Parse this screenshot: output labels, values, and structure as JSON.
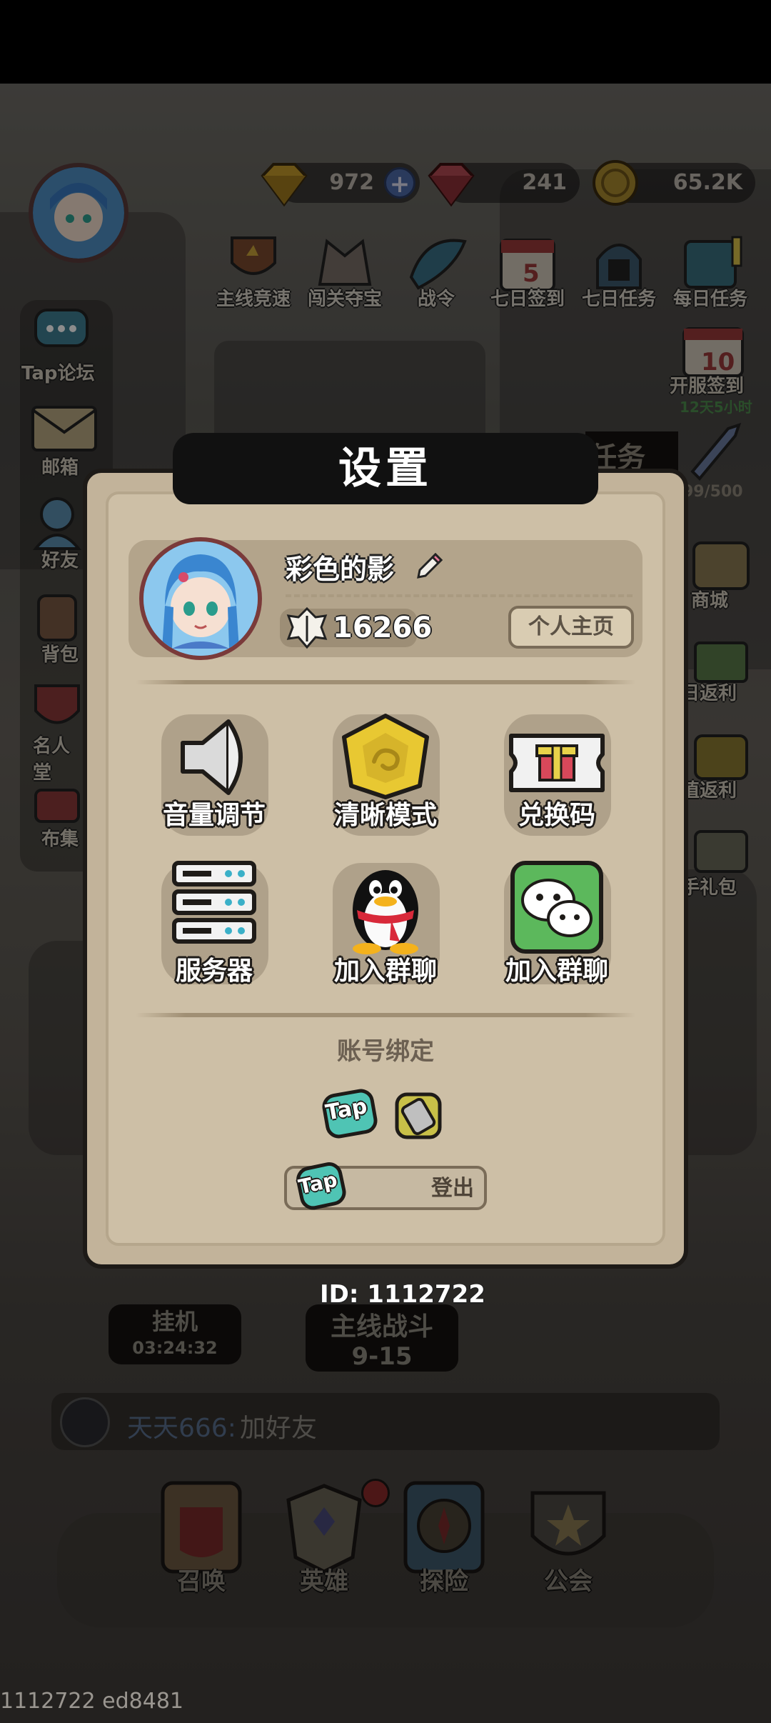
{
  "resources": [
    {
      "name": "gold-gem",
      "value": "972",
      "has_plus": true
    },
    {
      "name": "red-gem",
      "value": "241"
    },
    {
      "name": "coin",
      "value": "65.2K"
    }
  ],
  "top_icons": [
    {
      "label": "主线竞速",
      "icon": "trophy-icon"
    },
    {
      "label": "闯关夺宝",
      "icon": "treasure-icon"
    },
    {
      "label": "战令",
      "icon": "battle-pass-icon"
    },
    {
      "label": "七日签到",
      "icon": "calendar-icon"
    },
    {
      "label": "七日任务",
      "icon": "helmet-icon"
    },
    {
      "label": "每日任务",
      "icon": "tasks-icon"
    }
  ],
  "right_side": {
    "opening_signin": "开服签到",
    "opening_timer": "12天5小时",
    "task_banner": "任务",
    "progress": "99/500",
    "shop": "商城",
    "daily_rebate": "日返利",
    "recharge_rebate": "值返利",
    "newbie_gift": "手礼包"
  },
  "left_side": [
    {
      "label": "Tap论坛"
    },
    {
      "label": "邮箱"
    },
    {
      "label": "好友"
    },
    {
      "label": "背包"
    },
    {
      "label": "名人堂"
    },
    {
      "label": "布集"
    }
  ],
  "dialog": {
    "title": "设置",
    "username": "彩色的影",
    "power": "16266",
    "home_button": "个人主页",
    "options": [
      {
        "label": "音量调节",
        "icon": "speaker-icon"
      },
      {
        "label": "清晰模式",
        "icon": "clarity-icon"
      },
      {
        "label": "兑换码",
        "icon": "gift-code-icon"
      },
      {
        "label": "服务器",
        "icon": "server-icon"
      },
      {
        "label": "加入群聊",
        "icon": "qq-icon"
      },
      {
        "label": "加入群聊",
        "icon": "wechat-icon"
      }
    ],
    "account_binding": "账号绑定",
    "bind_tap": "Tap",
    "logout_tap": "Tap",
    "logout": "登出"
  },
  "id_text": "ID: 1112722",
  "hud": {
    "idle_label": "挂机",
    "idle_timer": "03:24:32",
    "main_battle_label": "主线战斗",
    "main_battle_stage": "9-15"
  },
  "chat": {
    "name": "天天666:",
    "message": "加好友"
  },
  "bottom_nav": [
    {
      "label": "召唤",
      "icon": "summon-icon"
    },
    {
      "label": "英雄",
      "icon": "hero-icon"
    },
    {
      "label": "探险",
      "icon": "compass-icon"
    },
    {
      "label": "公会",
      "icon": "guild-icon"
    }
  ],
  "version": "1112722 ed8481",
  "colors": {
    "dialog_bg": "#cdbfa6",
    "title_bg": "#111111",
    "wechat_green": "#5cb85c",
    "clarity_gold": "#e8c832"
  }
}
